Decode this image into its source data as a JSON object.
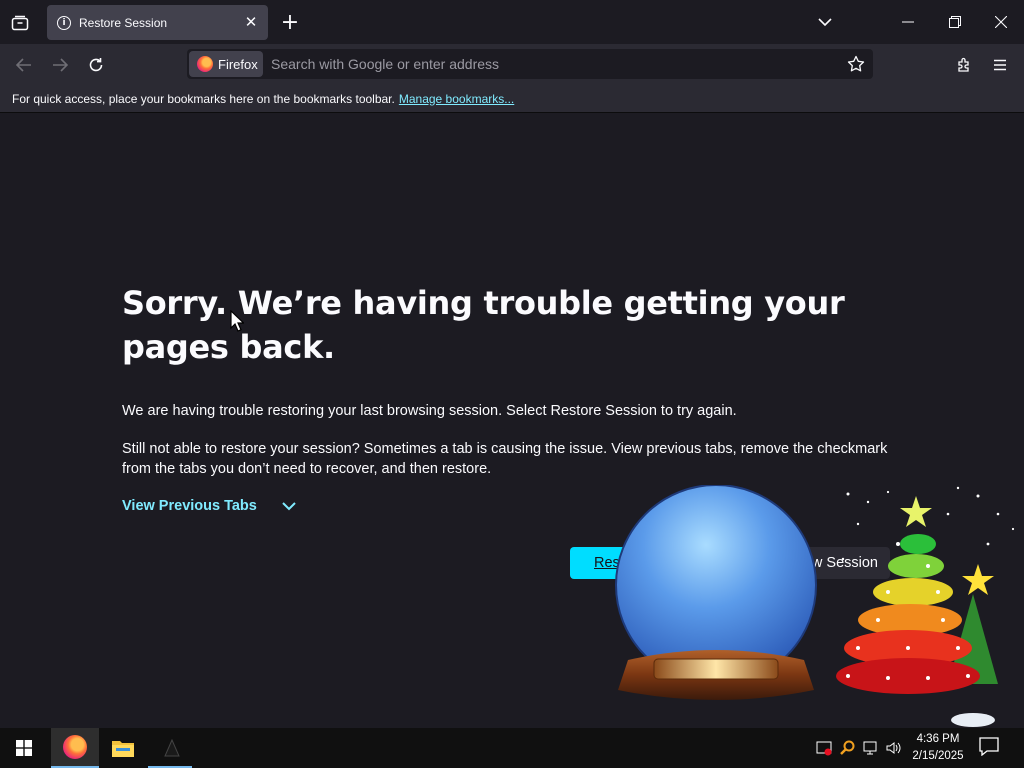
{
  "browser": {
    "tab": {
      "title": "Restore Session"
    },
    "urlbar": {
      "identity_label": "Firefox",
      "placeholder": "Search with Google or enter address"
    },
    "bookmarks_bar": {
      "message": "For quick access, place your bookmarks here on the bookmarks toolbar.",
      "manage_link": "Manage bookmarks..."
    }
  },
  "page": {
    "title": "Sorry. We’re having trouble getting your pages back.",
    "message_1": "We are having trouble restoring your last browsing session. Select Restore Session to try again.",
    "message_2": "Still not able to restore your session? Sometimes a tab is causing the issue. View previous tabs, remove the checkmark from the tabs you don’t need to recover, and then restore.",
    "view_previous_tabs": "View Previous Tabs",
    "restore_button_visible": "Res",
    "new_session_button_visible": "w Session"
  },
  "taskbar": {
    "clock_time": "4:36 PM",
    "clock_date": "2/15/2025"
  },
  "colors": {
    "accent": "#00ddff",
    "link": "#80ebff",
    "background": "#1c1b22",
    "toolbar": "#2b2a33"
  },
  "icons": [
    "tab-list-icon",
    "info-icon",
    "close-icon",
    "plus-icon",
    "chevron-down-icon",
    "minimize-icon",
    "restore-window-icon",
    "back-arrow-icon",
    "forward-arrow-icon",
    "reload-icon",
    "firefox-logo-icon",
    "star-icon",
    "extensions-icon",
    "menu-icon",
    "windows-start-icon",
    "firefox-taskbar-icon",
    "file-explorer-icon",
    "notification-icon"
  ]
}
